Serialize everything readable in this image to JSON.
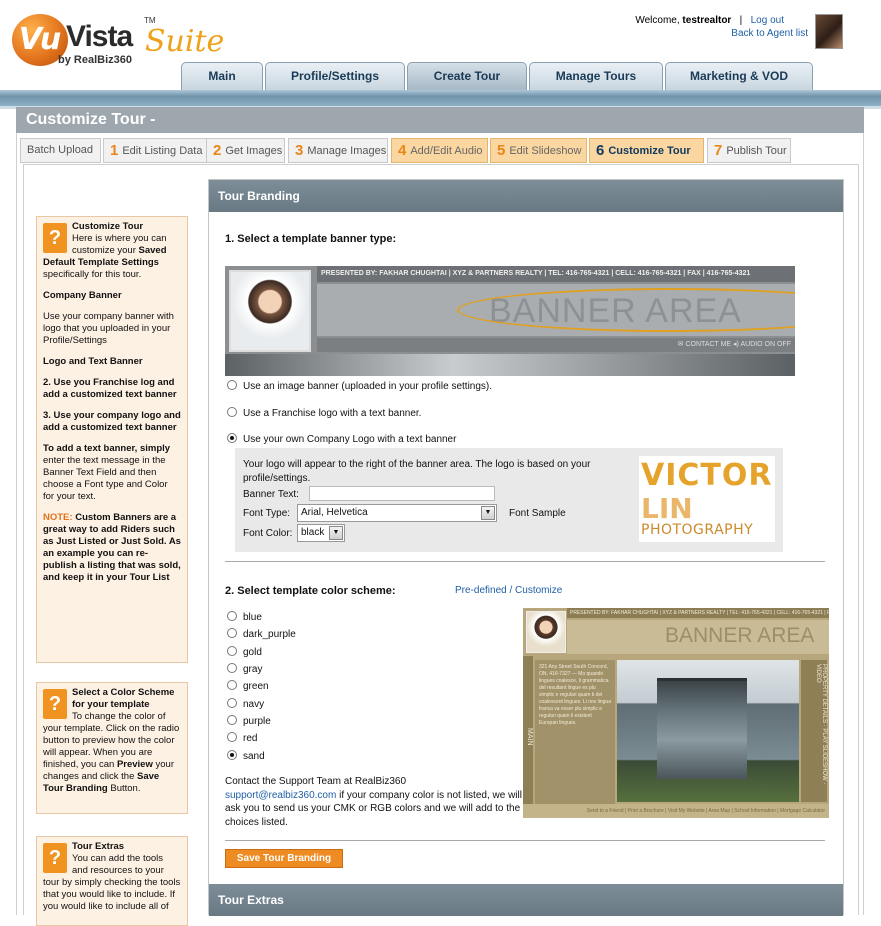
{
  "brand": {
    "vu": "Vu",
    "vista": "Vista",
    "tm": "TM",
    "suite": "Suite",
    "by": "by RealBiz360"
  },
  "user": {
    "welcome_prefix": "Welcome,",
    "username": "testrealtor",
    "separator": "|",
    "logout": "Log out",
    "back": "Back to Agent list"
  },
  "nav": {
    "tabs": [
      "Main",
      "Profile/Settings",
      "Create Tour",
      "Manage Tours",
      "Marketing & VOD"
    ],
    "active": "Create Tour"
  },
  "page_title": "Customize Tour -",
  "steps": [
    {
      "num": "",
      "label": "Batch Upload"
    },
    {
      "num": "1",
      "label": "Edit Listing Data"
    },
    {
      "num": "2",
      "label": "Get Images"
    },
    {
      "num": "3",
      "label": "Manage Images"
    },
    {
      "num": "4",
      "label": "Add/Edit Audio"
    },
    {
      "num": "5",
      "label": "Edit Slideshow"
    },
    {
      "num": "6",
      "label": "Customize Tour"
    },
    {
      "num": "7",
      "label": "Publish Tour"
    }
  ],
  "help": {
    "customize": {
      "title": "Customize Tour",
      "intro": "Here is where you can customize your",
      "bold1": "Saved Default Template Settings",
      "intro_end": "specifically for this tour.",
      "company_banner_title": "Company Banner",
      "company_banner_text": "Use your company banner with logo that you uploaded in your Profile/Settings",
      "logo_text_title": "Logo and Text Banner",
      "point2": "2. Use you Franchise log and add a customized text banner",
      "point3": "3. Use your company logo and add a customized text banner",
      "add_text_bold": "To add a text banner,",
      "add_text_bold2": "simply",
      "add_text_rest": "enter the text message in the Banner Text Field and then choose a Font type and Color for your text.",
      "note_label": "NOTE:",
      "note_text": "Custom Banners are a great way to add Riders such as Just Listed or Just Sold. As an example you can re-publish a listing that was sold, and keep it in your Tour List"
    },
    "color": {
      "title": "Select a Color Scheme for your template",
      "text1": "To change the color of your template. Click on the radio button to preview how the color will appear. When you are finished, you can",
      "preview": "Preview",
      "text2": "your changes and click the",
      "save": "Save Tour Branding",
      "text3": "Button."
    },
    "extras": {
      "title": "Tour Extras",
      "text": "You can add the tools and resources to your tour by simply checking the tools that you would like to include. If you would like to include all of"
    }
  },
  "branding": {
    "header": "Tour Branding",
    "section1": "1. Select a template banner type:",
    "banner_preview": {
      "presented": "PRESENTED BY: FAKHAR CHUGHTAI  |  XYZ & PARTNERS REALTY  |  TEL: 416-765-4321  |  CELL: 416-765-4321  |  FAX  |  416-765-4321",
      "area": "BANNER AREA",
      "controls": "✉ CONTACT ME     ◂) AUDIO  ON  OFF"
    },
    "options": [
      {
        "label": "Use an image banner (uploaded in your profile settings).",
        "checked": false
      },
      {
        "label": "Use a Franchise logo with a text banner.",
        "checked": false
      },
      {
        "label": "Use your own Company Logo with a text banner",
        "checked": true
      }
    ],
    "logo_info": "Your logo will appear to the right of the banner area. The logo is based on your profile/settings.",
    "banner_text_label": "Banner Text:",
    "banner_text_value": "",
    "font_type_label": "Font Type:",
    "font_type_value": "Arial, Helvetica",
    "font_sample": "Font Sample",
    "font_color_label": "Font Color:",
    "font_color_value": "black",
    "logo_sample": {
      "line1": "VICTOR",
      "line2": "LIN",
      "line3": "PHOTOGRAPHY"
    },
    "section2": "2. Select template color scheme:",
    "predefined": "Pre-defined / Customize",
    "schemes": [
      {
        "label": "blue",
        "checked": false
      },
      {
        "label": "dark_purple",
        "checked": false
      },
      {
        "label": "gold",
        "checked": false
      },
      {
        "label": "gray",
        "checked": false
      },
      {
        "label": "green",
        "checked": false
      },
      {
        "label": "navy",
        "checked": false
      },
      {
        "label": "purple",
        "checked": false
      },
      {
        "label": "red",
        "checked": false
      },
      {
        "label": "sand",
        "checked": true
      }
    ],
    "scheme_preview": {
      "strip": "PRESENTED BY: FAKHAR CHUGHTAI | XYZ & PARTNERS REALTY | TEL: 416-765-4321 | CELL: 416-765-4321 | FAX | 416-765-4321",
      "area": "BANNER AREA",
      "side": "MAIN",
      "info": "321 Any Street South Concord, ON, 416-7327 — Mo quando lingues coalesce, li grammatica del resultant lingue es plu simplic e regulari quam ti del coalescent lingues. Li nov lingua franca va esser plu simplic e regulari quam li existent Europan lingues.",
      "rside": "PROPERTY DETAILS · PLAY SLIDESHOW · VIDEO",
      "footer": "Send to a Friend  |  Print a Brochure  |  Visit My Website  |  Area Map  |  School Information  |  Mortgage Calculator"
    },
    "support_text1": "Contact the Support Team at RealBiz360",
    "support_email": "support@realbiz360.com",
    "support_text2": "if your company color is not listed, we will ask you to send us your CMK or RGB colors and we will add to the choices listed.",
    "save_button": "Save Tour Branding"
  },
  "extras_header": "Tour Extras",
  "colors": {
    "accent": "#ef8b23",
    "nav_bar": "#6f93ab",
    "panel_header": "#6e7f8a",
    "link": "#1f5fa6"
  }
}
